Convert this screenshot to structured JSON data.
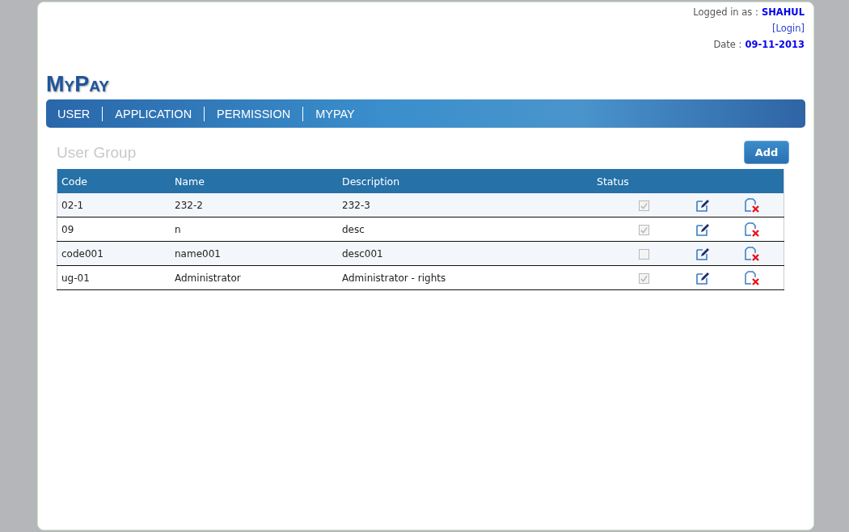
{
  "header": {
    "logged_in_label": "Logged in as :",
    "user": "SHAHUL",
    "login_link": "[Login]",
    "date_label": "Date :",
    "date": "09-11-2013"
  },
  "logo": "MyPay",
  "nav": [
    "USER",
    "APPLICATION",
    "PERMISSION",
    "MYPAY"
  ],
  "page_title": "User Group",
  "add_button": "Add",
  "table": {
    "columns": [
      "Code",
      "Name",
      "Description",
      "Status"
    ],
    "rows": [
      {
        "code": "02-1",
        "name": "232-2",
        "description": "232-3",
        "status": true
      },
      {
        "code": "09",
        "name": "n",
        "description": "desc",
        "status": true
      },
      {
        "code": "code001",
        "name": "name001",
        "description": "desc001",
        "status": false
      },
      {
        "code": "ug-01",
        "name": "Administrator",
        "description": "Administrator - rights",
        "status": true
      }
    ]
  }
}
